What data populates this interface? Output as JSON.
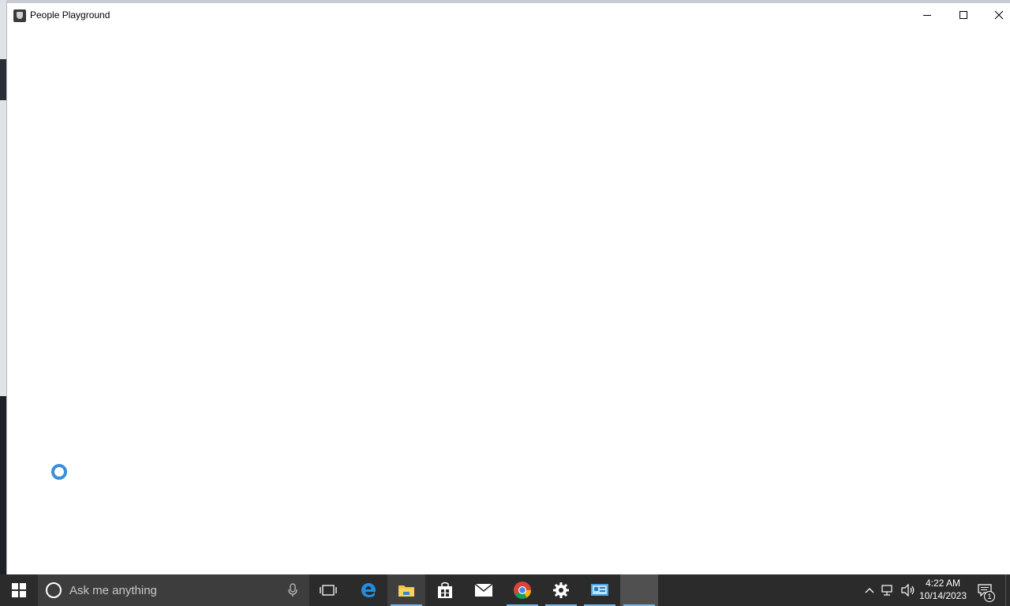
{
  "window": {
    "title": "People Playground"
  },
  "taskbar": {
    "search_placeholder": "Ask me anything",
    "apps": [
      {
        "name": "task-view"
      },
      {
        "name": "edge"
      },
      {
        "name": "file-explorer"
      },
      {
        "name": "store"
      },
      {
        "name": "mail"
      },
      {
        "name": "chrome"
      },
      {
        "name": "settings"
      },
      {
        "name": "control-panel"
      },
      {
        "name": "people-playground"
      }
    ],
    "clock": {
      "time": "4:22 AM",
      "date": "10/14/2023"
    },
    "notifications_count": "1"
  },
  "colors": {
    "taskbar": "#2b2b2b",
    "accent": "#76b9ed",
    "spinner": "#3b8fd9"
  }
}
